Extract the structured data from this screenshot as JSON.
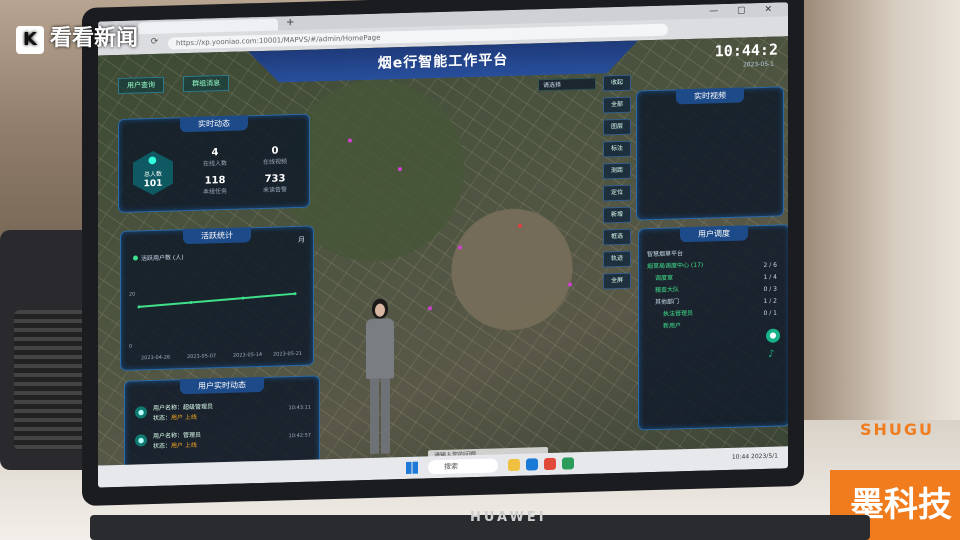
{
  "watermark": {
    "text": "看看新闻",
    "logo": "K"
  },
  "scene": {
    "brand": "HUAWEI",
    "sign_text": "墨科技",
    "shugu_text": "SHUGU"
  },
  "browser": {
    "address": "https://xp.yooniao.com:10001/MAPVS/#/admin/HomePage",
    "window_controls": "— ▢ ✕",
    "nav": "← → ⟳",
    "tab_plus": "+"
  },
  "app": {
    "title": "烟e行智能工作平台",
    "clock": "10:44:2",
    "date": "2023-05-1",
    "top_tabs": [
      "用户查询",
      "群组消息"
    ]
  },
  "realtime": {
    "title": "实时动态",
    "avatar_label": "总人数",
    "avatar_count": "101",
    "stats": [
      {
        "value": "4",
        "label": "在线人数"
      },
      {
        "value": "0",
        "label": "在线视频"
      },
      {
        "value": "118",
        "label": "本组任务"
      },
      {
        "value": "733",
        "label": "未读告警"
      }
    ]
  },
  "activity": {
    "title": "活跃统计",
    "month": "月",
    "legend": "活跃用户数 (人)",
    "x_labels": [
      "2023-04-26",
      "2023-05-07",
      "2023-05-14",
      "2023-05-21"
    ],
    "y_labels": [
      "20",
      "0"
    ]
  },
  "chart_data": {
    "type": "line",
    "title": "活跃统计",
    "x": [
      "2023-04-26",
      "2023-05-07",
      "2023-05-14",
      "2023-05-21"
    ],
    "series": [
      {
        "name": "活跃用户数 (人)",
        "values": [
          13,
          14,
          15,
          16
        ]
      }
    ],
    "ylim": [
      0,
      25
    ]
  },
  "user_panel": {
    "title": "用户实时动态",
    "rows": [
      {
        "name": "用户名称：超级管理员",
        "status_label": "状态：",
        "status": "用户 上线",
        "time": "10:43:11"
      },
      {
        "name": "用户名称：管理员",
        "status_label": "状态：",
        "status": "用户 上线",
        "time": "10:42:57"
      }
    ]
  },
  "right_top": {
    "title": "实时视频"
  },
  "right_bot": {
    "title": "用户调度",
    "tree": [
      "智慧烟草平台",
      "烟草局调度中心 (17)",
      "调度室",
      "稽查大队",
      "其他部门",
      "执法管理员",
      "新用户"
    ],
    "counts": [
      "2 / 6",
      "1 / 4",
      "0 / 3",
      "1 / 2",
      "0 / 1"
    ]
  },
  "toolbar": {
    "search_placeholder": "请选择",
    "tools": [
      "收起",
      "全部",
      "图层",
      "标注",
      "测距",
      "定位",
      "新增",
      "框选",
      "轨迹",
      "全屏"
    ]
  },
  "message_input": {
    "placeholder": "请输入您的问题"
  },
  "taskbar": {
    "search": "搜索",
    "right": "10:44 2023/5/1"
  },
  "colors": {
    "header": "#284f9c",
    "accent": "#3fe08a",
    "panel_border": "#2a6aa8",
    "status_online": "#f5a623"
  }
}
